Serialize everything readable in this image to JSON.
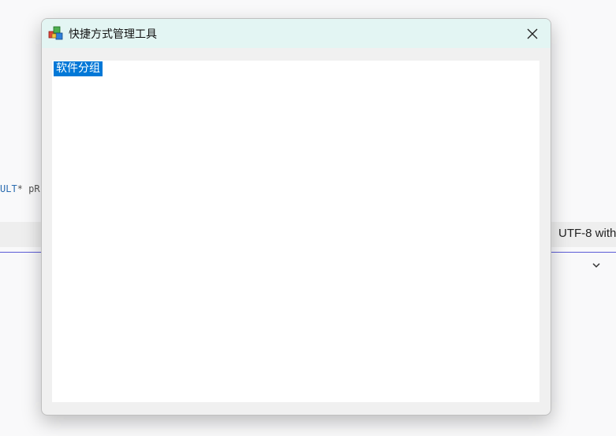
{
  "background": {
    "code_keyword": "ULT",
    "code_rest": "* pR",
    "encoding_label": "UTF-8 with",
    "chevron_icon": "chevron-down-icon"
  },
  "window": {
    "title": "快捷方式管理工具",
    "icon": "app-cubes-icon",
    "close_icon": "close-icon",
    "titlebar_color": "#e3f5f3"
  },
  "tree": {
    "items": [
      {
        "label": "软件分组",
        "selected": true
      }
    ],
    "selection_color": "#0078d7"
  }
}
